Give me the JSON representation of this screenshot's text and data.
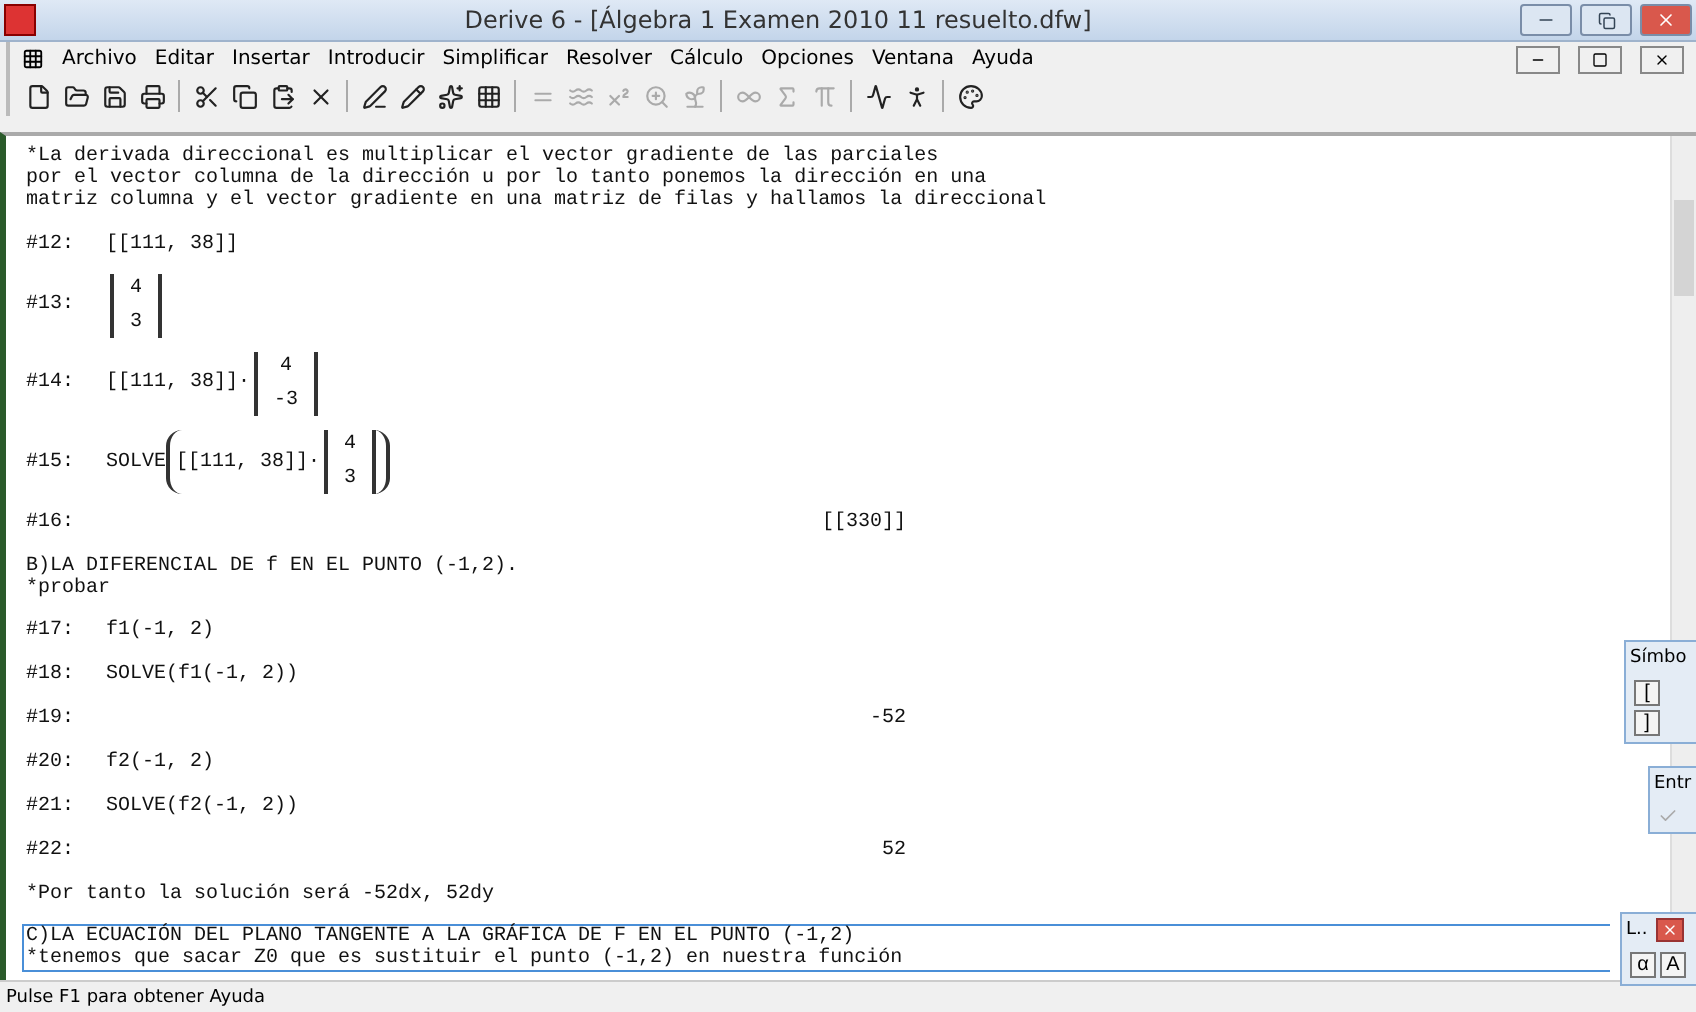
{
  "window": {
    "title": "Derive 6 - [Álgebra 1 Examen 2010 11 resuelto.dfw]"
  },
  "menu": [
    "Archivo",
    "Editar",
    "Insertar",
    "Introducir",
    "Simplificar",
    "Resolver",
    "Cálculo",
    "Opciones",
    "Ventana",
    "Ayuda"
  ],
  "document": [
    {
      "kind": "comment",
      "selected": false,
      "lines": [
        "*La derivada direccional es multiplicar el vector gradiente de las parciales",
        "por el vector columna de la dirección u por lo tanto ponemos la dirección en una",
        "matriz columna y el vector gradiente en una matriz de filas y hallamos la direccional"
      ]
    },
    {
      "kind": "expr",
      "label": "#12:",
      "parts": [
        {
          "kind": "text",
          "text": "[[111, 38]]"
        }
      ]
    },
    {
      "kind": "expr",
      "label": "#13:",
      "parts": [
        {
          "kind": "matrix",
          "cells": [
            "4",
            "3"
          ]
        }
      ]
    },
    {
      "kind": "expr",
      "label": "#14:",
      "parts": [
        {
          "kind": "text",
          "text": "[[111, 38]]·"
        },
        {
          "kind": "matrix",
          "cells": [
            "4",
            "-3"
          ]
        }
      ]
    },
    {
      "kind": "expr",
      "label": "#15:",
      "parts": [
        {
          "kind": "text",
          "text": "SOLVE"
        },
        {
          "kind": "paren",
          "children": [
            {
              "kind": "text",
              "text": "[[111, 38]]·"
            },
            {
              "kind": "matrix",
              "cells": [
                "4",
                "3"
              ]
            }
          ]
        }
      ]
    },
    {
      "kind": "result",
      "label": "#16:",
      "value": "[[330]]"
    },
    {
      "kind": "comment",
      "selected": false,
      "lines": [
        "B)LA DIFERENCIAL DE f EN EL PUNTO (-1,2).",
        "*probar"
      ]
    },
    {
      "kind": "expr",
      "label": "#17:",
      "parts": [
        {
          "kind": "text",
          "text": "f1(-1, 2)"
        }
      ]
    },
    {
      "kind": "expr",
      "label": "#18:",
      "parts": [
        {
          "kind": "text",
          "text": "SOLVE(f1(-1, 2))"
        }
      ]
    },
    {
      "kind": "result",
      "label": "#19:",
      "value": "-52"
    },
    {
      "kind": "expr",
      "label": "#20:",
      "parts": [
        {
          "kind": "text",
          "text": "f2(-1, 2)"
        }
      ]
    },
    {
      "kind": "expr",
      "label": "#21:",
      "parts": [
        {
          "kind": "text",
          "text": "SOLVE(f2(-1, 2))"
        }
      ]
    },
    {
      "kind": "result",
      "label": "#22:",
      "value": "52"
    },
    {
      "kind": "comment",
      "selected": false,
      "lines": [
        "*Por tanto la solución será -52dx, 52dy"
      ]
    },
    {
      "kind": "comment",
      "selected": true,
      "lines": [
        "C)LA ECUACIÓN DEL PLANO TANGENTE A LA GRÁFICA DE F EN EL PUNTO (-1,2)",
        "*tenemos que sacar Z0 que es sustituir el punto (-1,2) en nuestra función"
      ]
    }
  ],
  "palettes": [
    {
      "kind": "symbols",
      "title": "Símbo",
      "keys": [
        "[",
        "]"
      ]
    },
    {
      "kind": "entry",
      "title": "Entr"
    },
    {
      "kind": "letters",
      "title": "L..",
      "keys": [
        "α",
        "A"
      ]
    }
  ],
  "status_bar": "Pulse F1 para obtener Ayuda"
}
